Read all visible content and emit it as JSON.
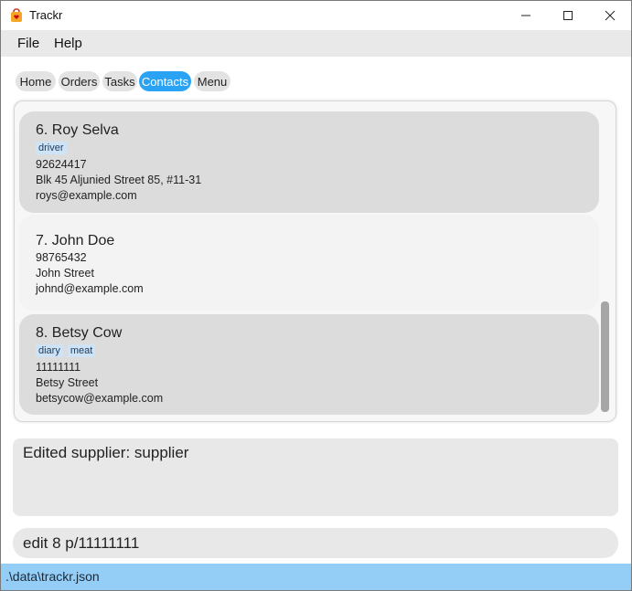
{
  "window": {
    "title": "Trackr"
  },
  "menu": {
    "file": "File",
    "help": "Help"
  },
  "tabs": [
    {
      "label": "Home",
      "active": false
    },
    {
      "label": "Orders",
      "active": false
    },
    {
      "label": "Tasks",
      "active": false
    },
    {
      "label": "Contacts",
      "active": true
    },
    {
      "label": "Menu",
      "active": false
    }
  ],
  "contacts": [
    {
      "name": "6.  Roy Selva",
      "tags": [
        "driver"
      ],
      "phone": "92624417",
      "address": "Blk 45 Aljunied Street 85, #11-31",
      "email": "roys@example.com"
    },
    {
      "name": "7.  John Doe",
      "tags": [],
      "phone": "98765432",
      "address": "John Street",
      "email": "johnd@example.com"
    },
    {
      "name": "8.  Betsy Cow",
      "tags": [
        "diary",
        "meat"
      ],
      "phone": "11111111",
      "address": "Betsy Street",
      "email": "betsycow@example.com"
    }
  ],
  "result": {
    "text": "Edited supplier: supplier"
  },
  "command": {
    "value": "edit 8 p/11111111"
  },
  "status": {
    "path": ".\\data\\trackr.json"
  },
  "colors": {
    "accent": "#2aa3f5",
    "status_bar": "#94cdf6",
    "tag_bg": "#cfe3f7"
  }
}
